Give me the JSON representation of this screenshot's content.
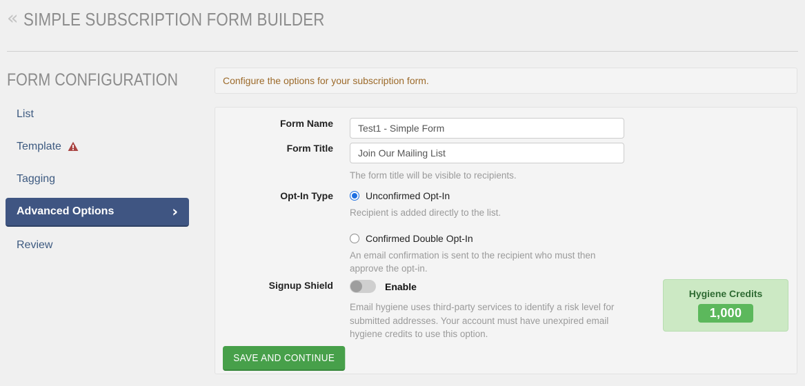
{
  "header": {
    "back_icon": "double-chevron-left-icon",
    "title": "SIMPLE SUBSCRIPTION FORM BUILDER"
  },
  "sidebar": {
    "title": "FORM CONFIGURATION",
    "items": [
      {
        "label": "List",
        "active": false,
        "warning": false
      },
      {
        "label": "Template",
        "active": false,
        "warning": true,
        "warning_icon": "warning-triangle-icon"
      },
      {
        "label": "Tagging",
        "active": false,
        "warning": false
      },
      {
        "label": "Advanced Options",
        "active": true,
        "warning": false,
        "chevron": "›"
      },
      {
        "label": "Review",
        "active": false,
        "warning": false
      }
    ]
  },
  "main": {
    "info_banner": "Configure the options for your subscription form.",
    "fields": {
      "form_name_label": "Form Name",
      "form_name_value": "Test1 - Simple Form",
      "form_title_label": "Form Title",
      "form_title_value": "Join Our Mailing List",
      "form_title_helper": "The form title will be visible to recipients.",
      "optin_label": "Opt-In Type",
      "optin_option1": "Unconfirmed Opt-In",
      "optin_option1_helper": "Recipient is added directly to the list.",
      "optin_option2": "Confirmed Double Opt-In",
      "optin_option2_helper": "An email confirmation is sent to the recipient who must then approve the opt-in.",
      "optin_selected": "Unconfirmed Opt-In",
      "shield_label": "Signup Shield",
      "shield_toggle_label": "Enable",
      "shield_toggle_state": "off",
      "shield_helper": "Email hygiene uses third-party services to identify a risk level for submitted addresses. Your account must have unexpired email hygiene credits to use this option."
    },
    "credits": {
      "title": "Hygiene Credits",
      "value": "1,000"
    },
    "save_button": "SAVE AND CONTINUE"
  },
  "colors": {
    "page_bg": "#f0f0f0",
    "panel_bg": "#f4f4f4",
    "nav_active": "#3f5582",
    "nav_link": "#3d5a80",
    "banner_text": "#9c6a2a",
    "warning": "#a94442",
    "radio_checked": "#1f6fe0",
    "credits_panel": "#cce9c4",
    "credits_badge": "#5cb85c",
    "save_button": "#47a04a"
  }
}
